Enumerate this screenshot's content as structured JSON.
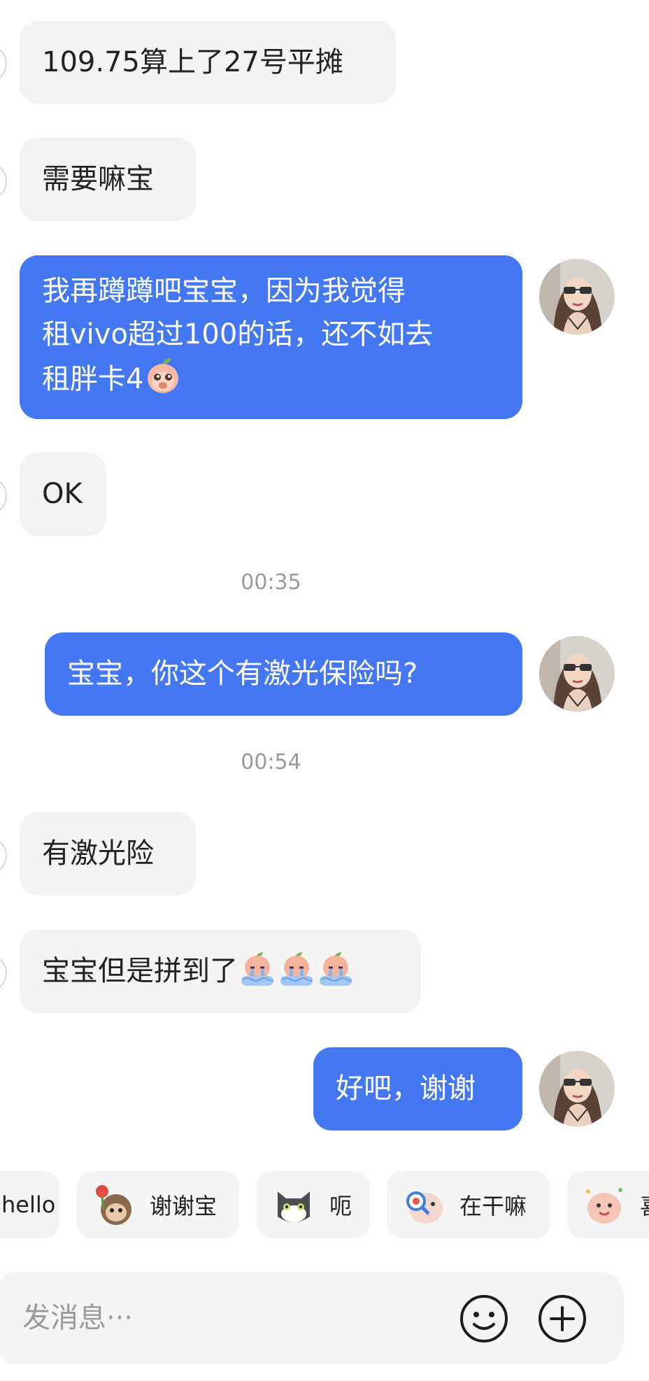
{
  "messages": [
    {
      "side": "in",
      "text": "109.75算上了27号平摊"
    },
    {
      "side": "in",
      "text": "需要嘛宝"
    },
    {
      "side": "out",
      "lines": [
        "我再蹲蹲吧宝宝，因为我觉得",
        "租vivo超过100的话，还不如去",
        "租胖卡4"
      ],
      "emoji": "crying-peach-emoji"
    },
    {
      "side": "in",
      "text": "OK"
    },
    {
      "type": "time",
      "text": "00:35"
    },
    {
      "side": "out",
      "text": "宝宝，你这个有激光保险吗?"
    },
    {
      "type": "time",
      "text": "00:54"
    },
    {
      "side": "in",
      "text": "有激光险"
    },
    {
      "side": "in",
      "text": "宝宝但是拼到了",
      "emoji": "sad-peach-emoji",
      "emoji_count": 3
    },
    {
      "side": "out",
      "text": "好吧，谢谢"
    }
  ],
  "quick_replies": [
    {
      "label": "hello"
    },
    {
      "label": "谢谢宝",
      "icon": "flower-monkey-sticker"
    },
    {
      "label": "呃",
      "icon": "gray-cat-sticker"
    },
    {
      "label": "在干嘛",
      "icon": "magnifier-peach-sticker"
    },
    {
      "label": "喜",
      "icon": "party-peach-sticker"
    }
  ],
  "input": {
    "placeholder": "发消息···"
  },
  "actions": {
    "emoji_button": "smiley-icon",
    "add_button": "plus-icon"
  },
  "colors": {
    "outgoing_bubble": "#4478f2",
    "incoming_bubble": "#f3f3f3",
    "timestamp": "#9a9a9a"
  }
}
